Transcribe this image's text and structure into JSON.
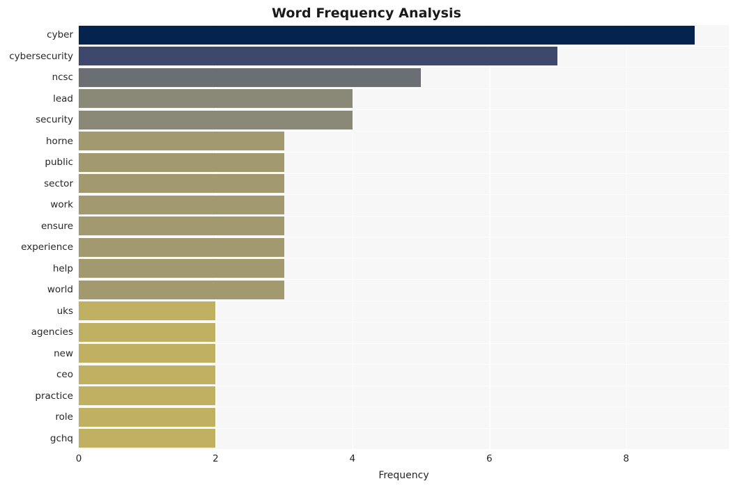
{
  "chart_data": {
    "type": "bar",
    "orientation": "horizontal",
    "title": "Word Frequency Analysis",
    "xlabel": "Frequency",
    "ylabel": "",
    "xlim": [
      0,
      9.5
    ],
    "xticks": [
      0,
      2,
      4,
      6,
      8
    ],
    "xtick_labels": [
      "0",
      "2",
      "4",
      "6",
      "8"
    ],
    "grid": true,
    "grid_color": "#ffffff",
    "plot_background": "#f7f7f7",
    "figure_background": "#ffffff",
    "legend": null,
    "colormap": "cividis",
    "categories": [
      "cyber",
      "cybersecurity",
      "ncsc",
      "lead",
      "security",
      "horne",
      "public",
      "sector",
      "work",
      "ensure",
      "experience",
      "help",
      "world",
      "uks",
      "agencies",
      "new",
      "ceo",
      "practice",
      "role",
      "gchq"
    ],
    "values": [
      9,
      7,
      5,
      4,
      4,
      3,
      3,
      3,
      3,
      3,
      3,
      3,
      3,
      2,
      2,
      2,
      2,
      2,
      2,
      2
    ],
    "bar_colors": [
      "#04244f",
      "#3d486c",
      "#6b6e73",
      "#8a8877",
      "#8a8877",
      "#a3996f",
      "#a3996f",
      "#a3996f",
      "#a3996f",
      "#a3996f",
      "#a3996f",
      "#a3996f",
      "#a3996f",
      "#c0b062",
      "#c0b062",
      "#c0b062",
      "#c0b062",
      "#c0b062",
      "#c0b062",
      "#c0b062"
    ]
  }
}
